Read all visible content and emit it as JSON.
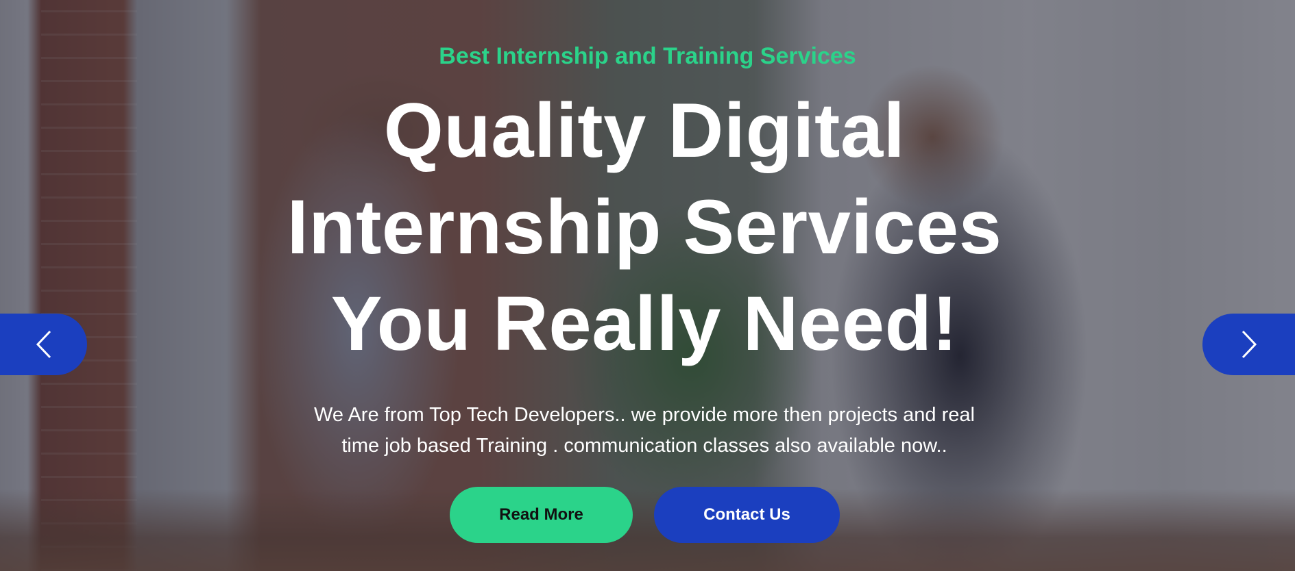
{
  "hero": {
    "eyebrow": "Best Internship and Training Services",
    "headline_lines": [
      "Quality Digital",
      "Internship Services",
      "You Really Need!"
    ],
    "description_lines": [
      "We Are from Top Tech Developers.. we provide more then projects and real",
      "time job based Training . communication classes also available now.."
    ],
    "buttons": {
      "read_more": "Read More",
      "contact_us": "Contact Us"
    }
  },
  "carousel": {
    "prev_icon": "chevron-left-icon",
    "next_icon": "chevron-right-icon"
  },
  "colors": {
    "accent_green": "#2bd38a",
    "brand_blue": "#1b3fbf",
    "text_white": "#ffffff"
  }
}
